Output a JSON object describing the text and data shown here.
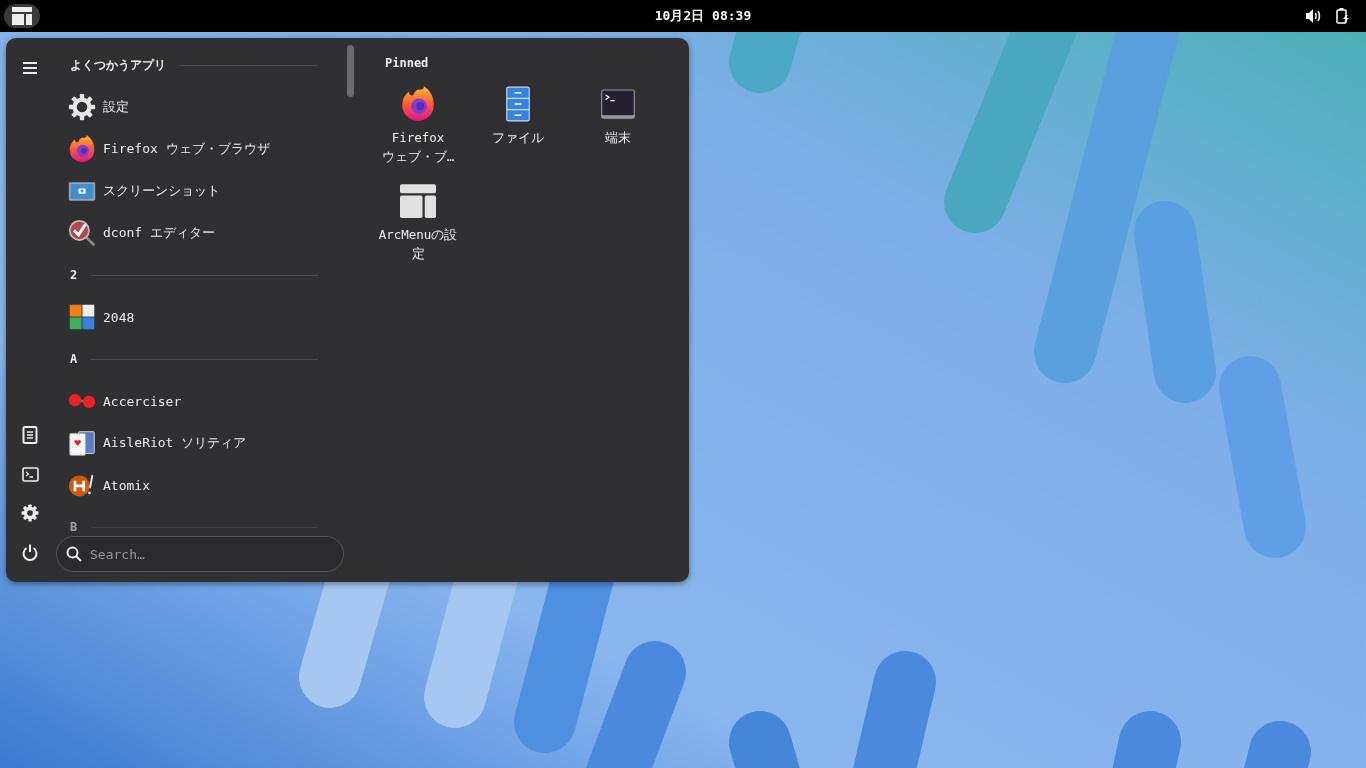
{
  "top_bar": {
    "clock": "10月2日 08:39"
  },
  "menu": {
    "sections": [
      {
        "title": "よくつかうアプリ",
        "faded": false,
        "apps": [
          {
            "name": "設定",
            "kind": "gear"
          },
          {
            "name": "Firefox ウェブ・ブラウザ",
            "kind": "firefox"
          },
          {
            "name": "スクリーンショット",
            "kind": "screenshot"
          },
          {
            "name": "dconf エディター",
            "kind": "dconf"
          }
        ]
      },
      {
        "title": "2",
        "faded": false,
        "apps": [
          {
            "name": "2048",
            "kind": "tiles"
          }
        ]
      },
      {
        "title": "A",
        "faded": false,
        "apps": [
          {
            "name": "Accerciser",
            "kind": "accerciser"
          },
          {
            "name": "AisleRiot ソリティア",
            "kind": "cards"
          },
          {
            "name": "Atomix",
            "kind": "atomix"
          }
        ]
      },
      {
        "title": "B",
        "faded": true
      }
    ],
    "search": {
      "placeholder": "Search…"
    },
    "pinned": {
      "title": "Pinned",
      "apps": [
        {
          "name": "Firefox ウェブ・ブ…",
          "kind": "firefox"
        },
        {
          "name": "ファイル",
          "kind": "files"
        },
        {
          "name": "端末",
          "kind": "terminal"
        },
        {
          "name": "ArcMenuの設定",
          "kind": "arcmenu"
        }
      ]
    }
  }
}
